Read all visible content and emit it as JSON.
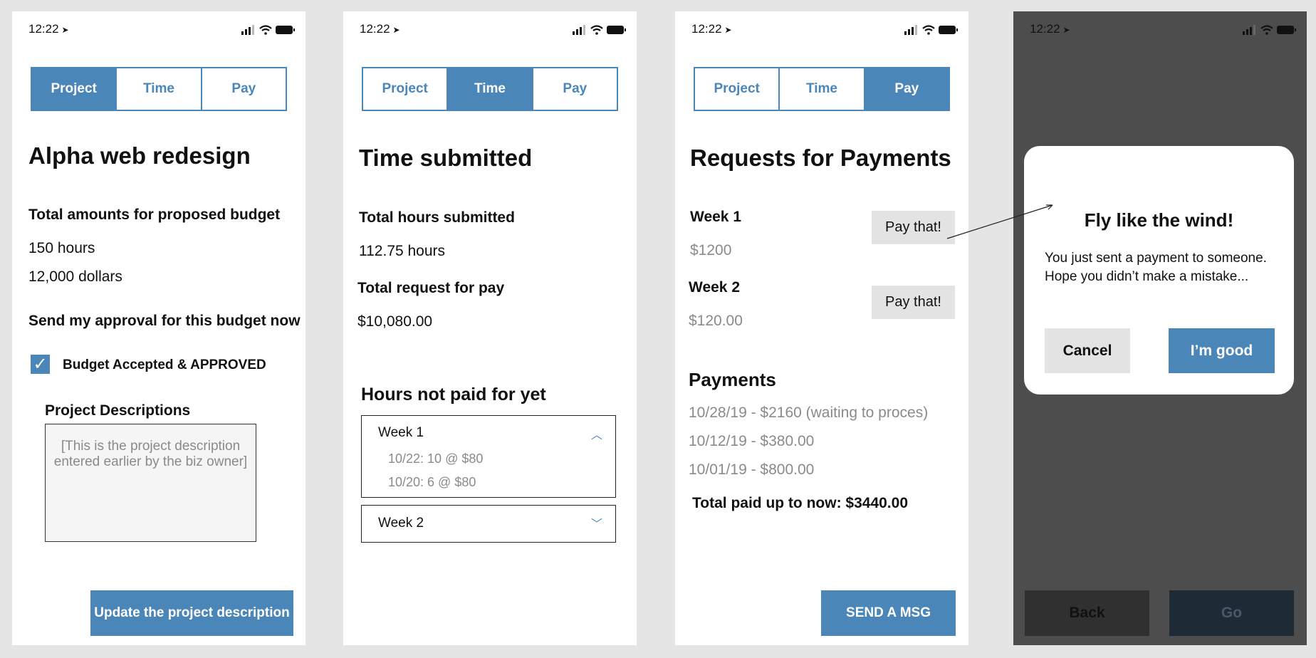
{
  "status": {
    "time": "12:22"
  },
  "tabs": [
    "Project",
    "Time",
    "Pay"
  ],
  "screen1": {
    "title": "Alpha web redesign",
    "budget_heading": "Total amounts for proposed budget",
    "hours": "150 hours",
    "dollars": "12,000 dollars",
    "approval_heading": "Send my approval for this budget now",
    "checkbox_mark": "✓",
    "checkbox_label": "Budget Accepted & APPROVED",
    "desc_heading": "Project Descriptions",
    "desc_text": "[This is the project description entered earlier by the biz owner]",
    "update_button": "Update the project description"
  },
  "screen2": {
    "title": "Time submitted",
    "hours_heading": "Total hours submitted",
    "hours_value": "112.75 hours",
    "pay_heading": "Total request for pay",
    "pay_value": "$10,080.00",
    "unpaid_heading": "Hours not paid for yet",
    "week1": {
      "label": "Week 1",
      "entries": [
        "10/22: 10 @ $80",
        "10/20: 6 @ $80"
      ]
    },
    "week2": {
      "label": "Week 2"
    }
  },
  "screen3": {
    "title": "Requests for Payments",
    "requests": [
      {
        "week": "Week 1",
        "amount": "$1200",
        "button": "Pay that!"
      },
      {
        "week": "Week 2",
        "amount": "$120.00",
        "button": "Pay that!"
      }
    ],
    "payments_heading": "Payments",
    "payments": [
      "10/28/19 - $2160 (waiting to proces)",
      "10/12/19 - $380.00",
      "10/01/19 - $800.00"
    ],
    "total": "Total paid up to now: $3440.00",
    "send_button": "SEND A MSG"
  },
  "screen4": {
    "modal_title": "Fly like the wind!",
    "modal_line1": "You just sent a payment to someone.",
    "modal_line2": "Hope you didn’t make a mistake...",
    "cancel": "Cancel",
    "confirm": "I’m good",
    "back": "Back",
    "go": "Go"
  },
  "colors": {
    "accent": "#4a86b8",
    "overlay": "#4d4d4d",
    "gray_button": "#e3e3e3"
  },
  "icons": [
    "location-arrow-icon",
    "signal-icon",
    "wifi-icon",
    "battery-icon",
    "checkmark-icon",
    "chevron-up-icon",
    "chevron-down-icon"
  ]
}
